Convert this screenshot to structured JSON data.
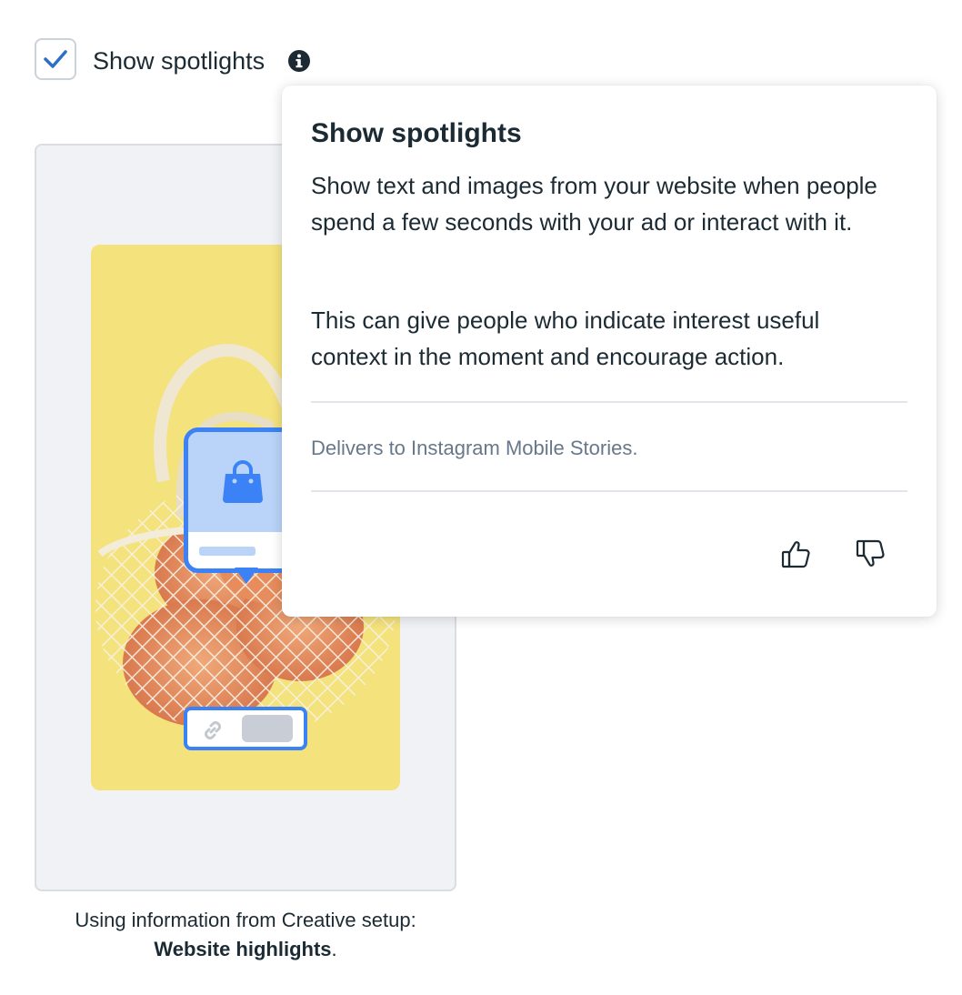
{
  "setting": {
    "label": "Show spotlights",
    "checked": true
  },
  "tooltip": {
    "title": "Show spotlights",
    "paragraph1": "Show text and images from your website when people spend a few seconds with your ad or interact with it.",
    "paragraph2": "This can give people who indicate interest useful context in the moment and encourage action.",
    "delivers": "Delivers to Instagram Mobile Stories.",
    "feedback": {
      "up_icon": "thumbs-up-icon",
      "down_icon": "thumbs-down-icon"
    }
  },
  "preview": {
    "caption_prefix": "Using information from Creative setup:",
    "caption_bold": "Website highlights",
    "caption_suffix": "."
  },
  "colors": {
    "accent": "#3b82f6",
    "check": "#2d6fc4",
    "background_yellow": "#f4e27c"
  }
}
